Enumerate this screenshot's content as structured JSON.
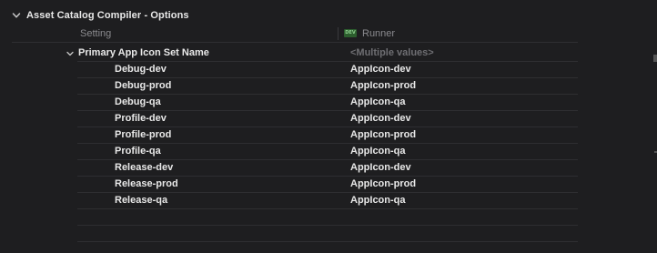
{
  "section": {
    "title": "Asset Catalog Compiler - Options"
  },
  "columns": {
    "setting": "Setting",
    "target_badge": "DEV",
    "target": "Runner"
  },
  "parent_row": {
    "name": "Primary App Icon Set Name",
    "value": "<Multiple values>"
  },
  "rows": [
    {
      "name": "Debug-dev",
      "value": "AppIcon-dev"
    },
    {
      "name": "Debug-prod",
      "value": "AppIcon-prod"
    },
    {
      "name": "Debug-qa",
      "value": "AppIcon-qa"
    },
    {
      "name": "Profile-dev",
      "value": "AppIcon-dev"
    },
    {
      "name": "Profile-prod",
      "value": "AppIcon-prod"
    },
    {
      "name": "Profile-qa",
      "value": "AppIcon-qa"
    },
    {
      "name": "Release-dev",
      "value": "AppIcon-dev"
    },
    {
      "name": "Release-prod",
      "value": "AppIcon-prod"
    },
    {
      "name": "Release-qa",
      "value": "AppIcon-qa"
    }
  ],
  "icons": {
    "section_toggle": "chevron-down-icon",
    "row_toggle": "chevron-down-icon"
  }
}
